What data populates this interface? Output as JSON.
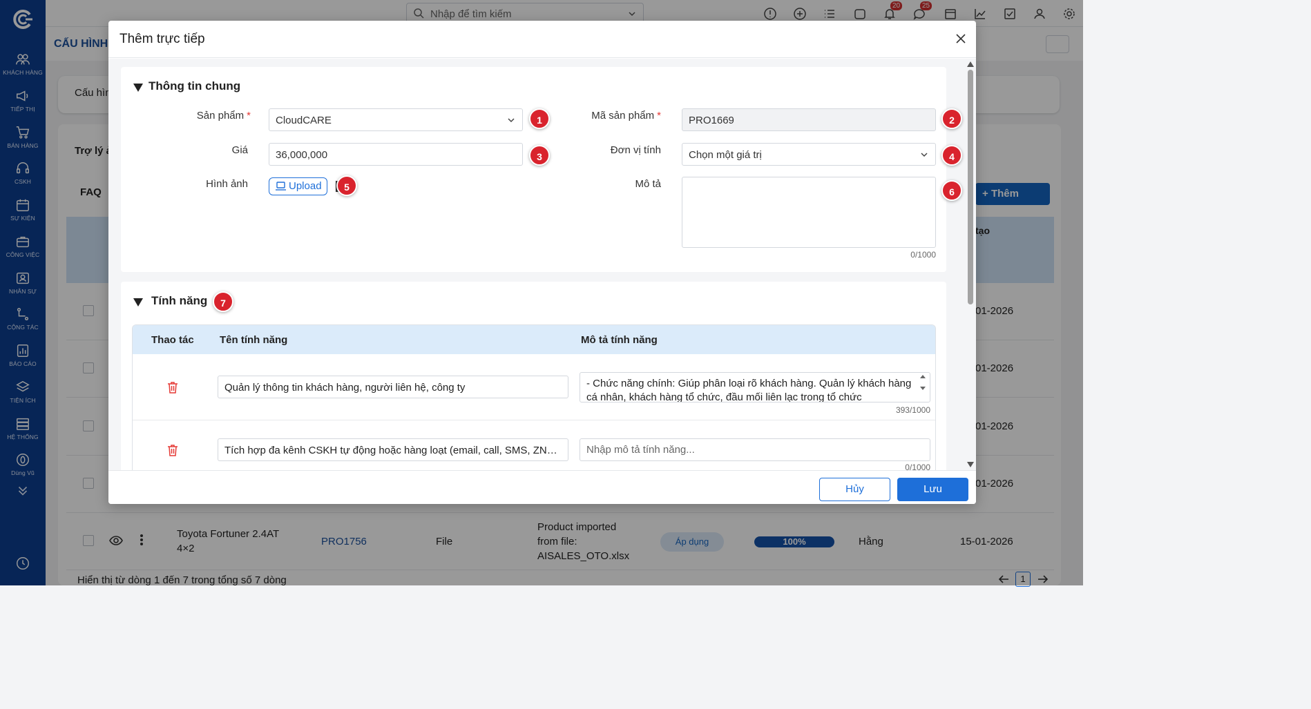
{
  "sidebar": {
    "items": [
      {
        "label": "KHÁCH HÀNG",
        "icon": "users-icon"
      },
      {
        "label": "TIẾP THỊ",
        "icon": "megaphone-icon"
      },
      {
        "label": "BÁN HÀNG",
        "icon": "cart-icon"
      },
      {
        "label": "CSKH",
        "icon": "headset-icon"
      },
      {
        "label": "SỰ KIỆN",
        "icon": "calendar-icon"
      },
      {
        "label": "CÔNG VIỆC",
        "icon": "briefcase-icon"
      },
      {
        "label": "NHÂN SỰ",
        "icon": "id-card-icon"
      },
      {
        "label": "CỘNG TÁC",
        "icon": "network-icon"
      },
      {
        "label": "BÁO CÁO",
        "icon": "report-icon"
      },
      {
        "label": "TIỆN ÍCH",
        "icon": "layers-icon"
      },
      {
        "label": "HỆ THỐNG",
        "icon": "server-icon"
      },
      {
        "label": "Dùng Vũ",
        "icon": "coin-icon"
      }
    ]
  },
  "topbar": {
    "search_placeholder": "Nhập để tìm kiếm",
    "notification_count": "20",
    "message_count": "25"
  },
  "background": {
    "page_title": "CẤU HÌNH",
    "tab_label": "Cấu hìn",
    "panel_title": "Trợ lý ả",
    "faq_label": "FAQ",
    "add_label": "Thêm",
    "col_created": "tạo",
    "dates": [
      "01-2026",
      "01-2026",
      "01-2026",
      "01-2026"
    ],
    "last_row": {
      "name_line1": "Toyota Fortuner 2.4AT",
      "name_line2": "4×2",
      "code": "PRO1756",
      "type": "File",
      "source_line1": "Product imported",
      "source_line2": "from file:",
      "source_line3": "AISALES_OTO.xlsx",
      "status": "Áp dụng",
      "progress": "100%",
      "owner": "Hằng",
      "date": "15-01-2026"
    },
    "footer_text": "Hiển thị từ dòng 1 đến 7 trong tổng số 7 dòng",
    "current_page": "1"
  },
  "modal": {
    "title": "Thêm trực tiếp",
    "general": {
      "title": "Thông tin chung",
      "product_label": "Sản phẩm",
      "product_value": "CloudCARE",
      "code_label": "Mã sản phẩm",
      "code_value": "PRO1669",
      "price_label": "Giá",
      "price_value": "36,000,000",
      "unit_label": "Đơn vị tính",
      "unit_placeholder": "Chọn một giá trị",
      "image_label": "Hình ảnh",
      "upload_label": "Upload",
      "desc_label": "Mô tả",
      "desc_counter": "0/1000"
    },
    "features": {
      "title": "Tính năng",
      "col_action": "Thao tác",
      "col_name": "Tên tính năng",
      "col_desc": "Mô tả tính năng",
      "rows": [
        {
          "name": "Quản lý thông tin khách hàng, người liên hệ, công ty",
          "desc": "- Chức năng chính: Giúp phân loại rõ khách hàng. Quản lý khách hàng cá nhân, khách hàng tổ chức, đầu mối liên lạc trong tổ chức",
          "counter": "393/1000"
        },
        {
          "name": "Tích hợp đa kênh CSKH tự động hoặc hàng loạt (email, call, SMS, ZNS...",
          "desc_placeholder": "Nhập mô tả tính năng...",
          "counter": "0/1000"
        }
      ]
    },
    "markers": [
      "1",
      "2",
      "3",
      "4",
      "5",
      "6",
      "7"
    ],
    "cancel_label": "Hủy",
    "save_label": "Lưu"
  },
  "colors": {
    "sidebar_bg": "#0d3f8f",
    "primary": "#1e6fd9",
    "marker": "#d9232d",
    "table_header": "#dbebfa"
  }
}
